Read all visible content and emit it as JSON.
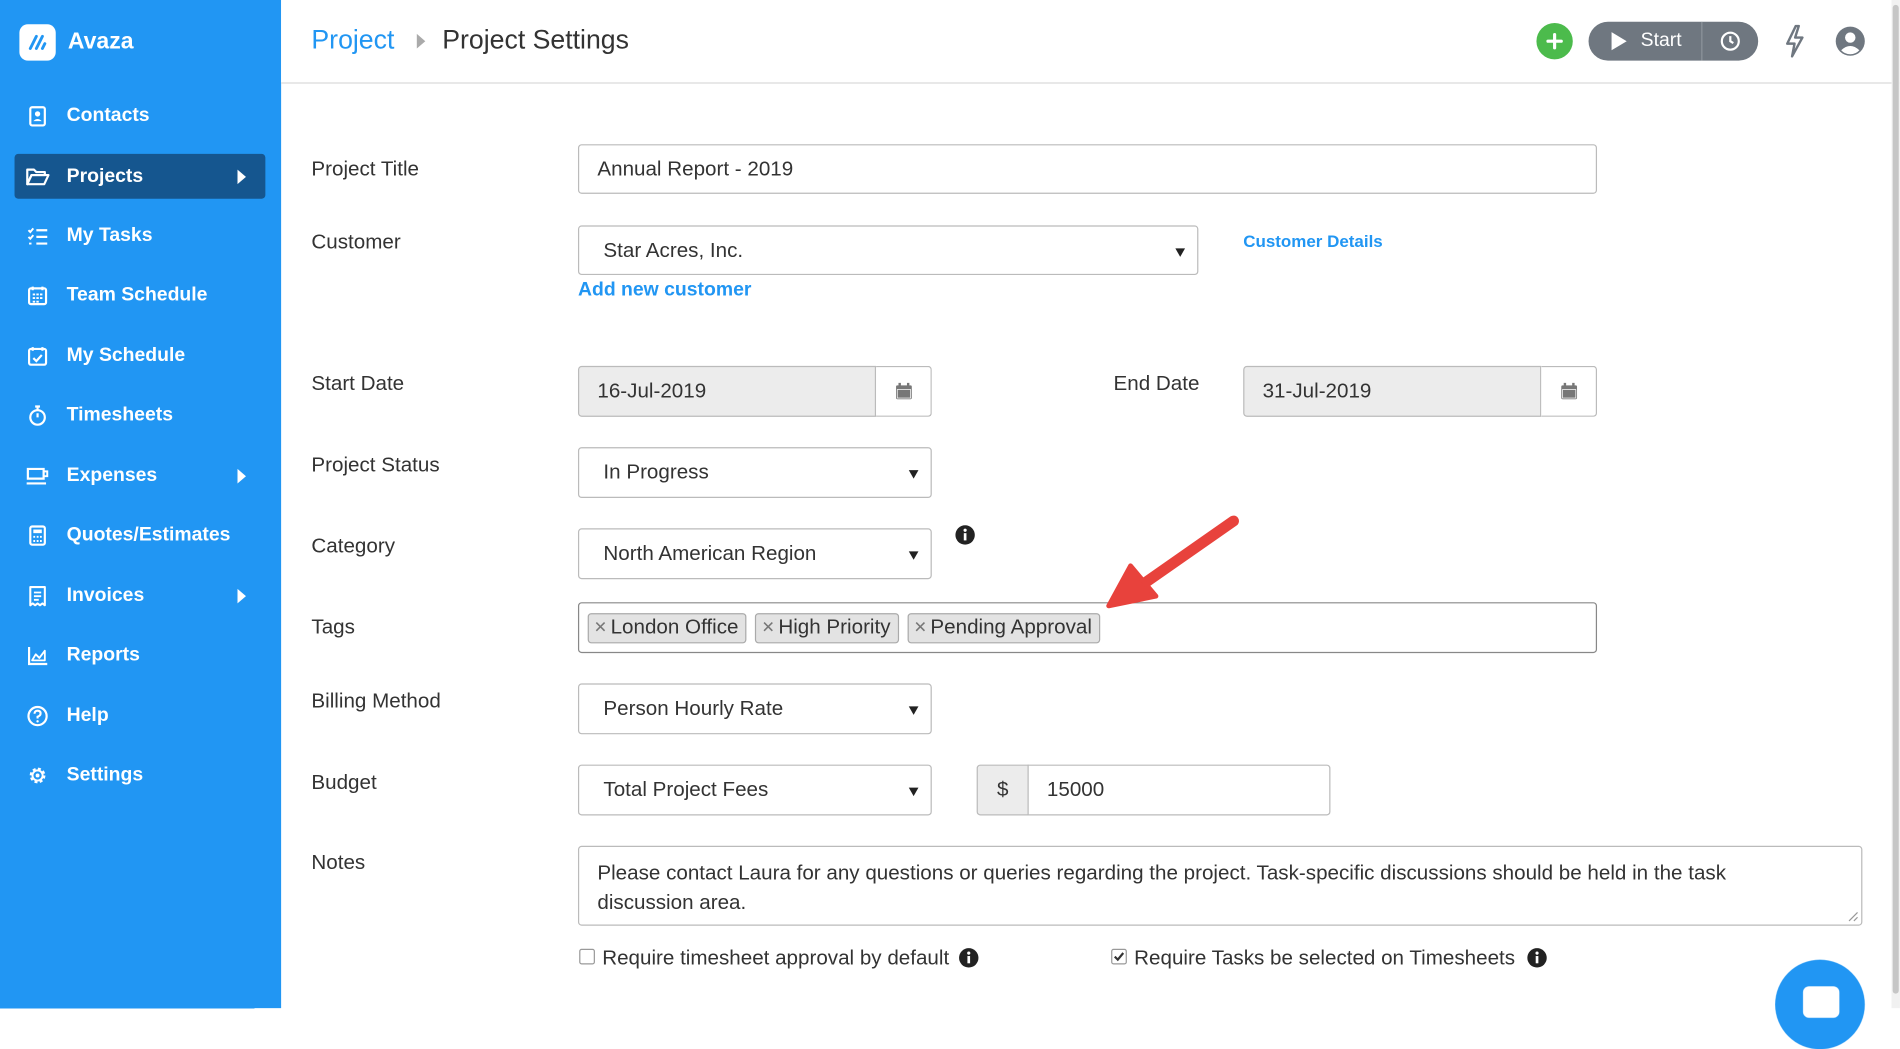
{
  "app": {
    "name": "Avaza"
  },
  "sidebar": {
    "items": [
      {
        "label": "Contacts"
      },
      {
        "label": "Projects"
      },
      {
        "label": "My Tasks"
      },
      {
        "label": "Team Schedule"
      },
      {
        "label": "My Schedule"
      },
      {
        "label": "Timesheets"
      },
      {
        "label": "Expenses"
      },
      {
        "label": "Quotes/Estimates"
      },
      {
        "label": "Invoices"
      },
      {
        "label": "Reports"
      },
      {
        "label": "Help"
      },
      {
        "label": "Settings"
      }
    ]
  },
  "header": {
    "breadcrumb_parent": "Project",
    "page_title": "Project Settings",
    "timer_label": "Start"
  },
  "form": {
    "project_title": {
      "label": "Project Title",
      "value": "Annual Report - 2019"
    },
    "customer": {
      "label": "Customer",
      "value": "Star Acres, Inc.",
      "details_link": "Customer Details",
      "add_link": "Add new customer"
    },
    "start_date": {
      "label": "Start Date",
      "value": "16-Jul-2019"
    },
    "end_date": {
      "label": "End Date",
      "value": "31-Jul-2019"
    },
    "project_status": {
      "label": "Project Status",
      "value": "In Progress"
    },
    "category": {
      "label": "Category",
      "value": "North American Region"
    },
    "tags": {
      "label": "Tags",
      "items": [
        "London Office",
        "High Priority",
        "Pending Approval"
      ]
    },
    "billing_method": {
      "label": "Billing Method",
      "value": "Person Hourly Rate"
    },
    "budget": {
      "label": "Budget",
      "type": "Total Project Fees",
      "currency": "$",
      "amount": "15000"
    },
    "notes": {
      "label": "Notes",
      "value": "Please contact Laura for any questions or queries regarding the project. Task-specific discussions should be held in the task discussion area."
    },
    "timesheet_approval": {
      "label": "Require timesheet approval by default",
      "checked": false
    },
    "require_tasks": {
      "label": "Require Tasks be selected on Timesheets",
      "checked": true
    }
  },
  "colors": {
    "sidebar": "#2196f3",
    "sidebar_active": "#15568f",
    "accent": "#2196f3",
    "add_button": "#4cbb4c",
    "annotation_arrow": "#e8423c"
  }
}
